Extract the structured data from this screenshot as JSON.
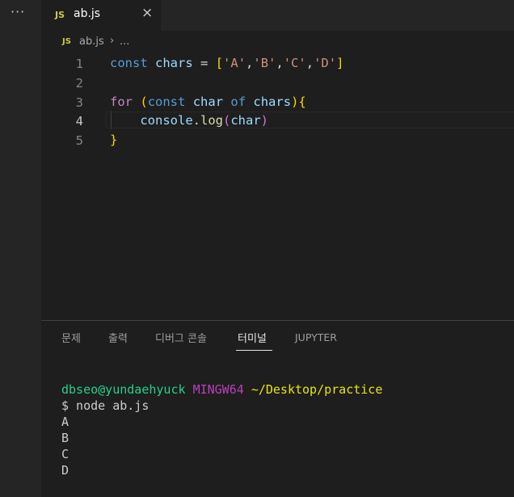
{
  "activity_bar": {
    "more_icon": "···"
  },
  "tab": {
    "icon": "JS",
    "label": "ab.js",
    "close_icon": "×"
  },
  "breadcrumb": {
    "icon": "JS",
    "file": "ab.js",
    "separator": "›",
    "rest": "..."
  },
  "editor": {
    "line_numbers": [
      "1",
      "2",
      "3",
      "4",
      "5"
    ],
    "active_line": "4",
    "line1": {
      "kw": "const",
      "sp1": " ",
      "ident": "chars",
      "eq": " = ",
      "open": "[",
      "a": "'A'",
      "c1": ",",
      "b": "'B'",
      "c2": ",",
      "c": "'C'",
      "c3": ",",
      "d": "'D'",
      "close": "]"
    },
    "line3": {
      "kw_for": "for",
      "sp1": " ",
      "open": "(",
      "kw_const": "const",
      "sp2": " ",
      "ident": "char",
      "sp3": " ",
      "kw_of": "of",
      "sp4": " ",
      "iter": "chars",
      "close": ")",
      "brace": "{"
    },
    "line4": {
      "indent": "    ",
      "obj": "console",
      "dot": ".",
      "fn": "log",
      "open": "(",
      "arg": "char",
      "close": ")"
    },
    "line5": {
      "brace": "}"
    }
  },
  "panel": {
    "tabs": [
      "문제",
      "출력",
      "디버그 콘솔",
      "터미널",
      "JUPYTER"
    ],
    "active_tab": "터미널"
  },
  "terminal": {
    "prompt_user": "dbseo@yundaehyuck",
    "prompt_host": "MINGW64",
    "prompt_path": "~/Desktop/practice",
    "command": "$ node ab.js",
    "output": [
      "A",
      "B",
      "C",
      "D"
    ]
  },
  "colors": {
    "keyword": "#569cd6",
    "control": "#c586c0",
    "variable": "#9cdcfe",
    "string": "#ce9178",
    "bracket_level1": "#ffd700",
    "bracket_level2": "#da70d6",
    "function": "#dcdcaa",
    "terminal_user": "#23d18b",
    "terminal_host": "#bc3fbc",
    "terminal_path": "#e5e510"
  }
}
